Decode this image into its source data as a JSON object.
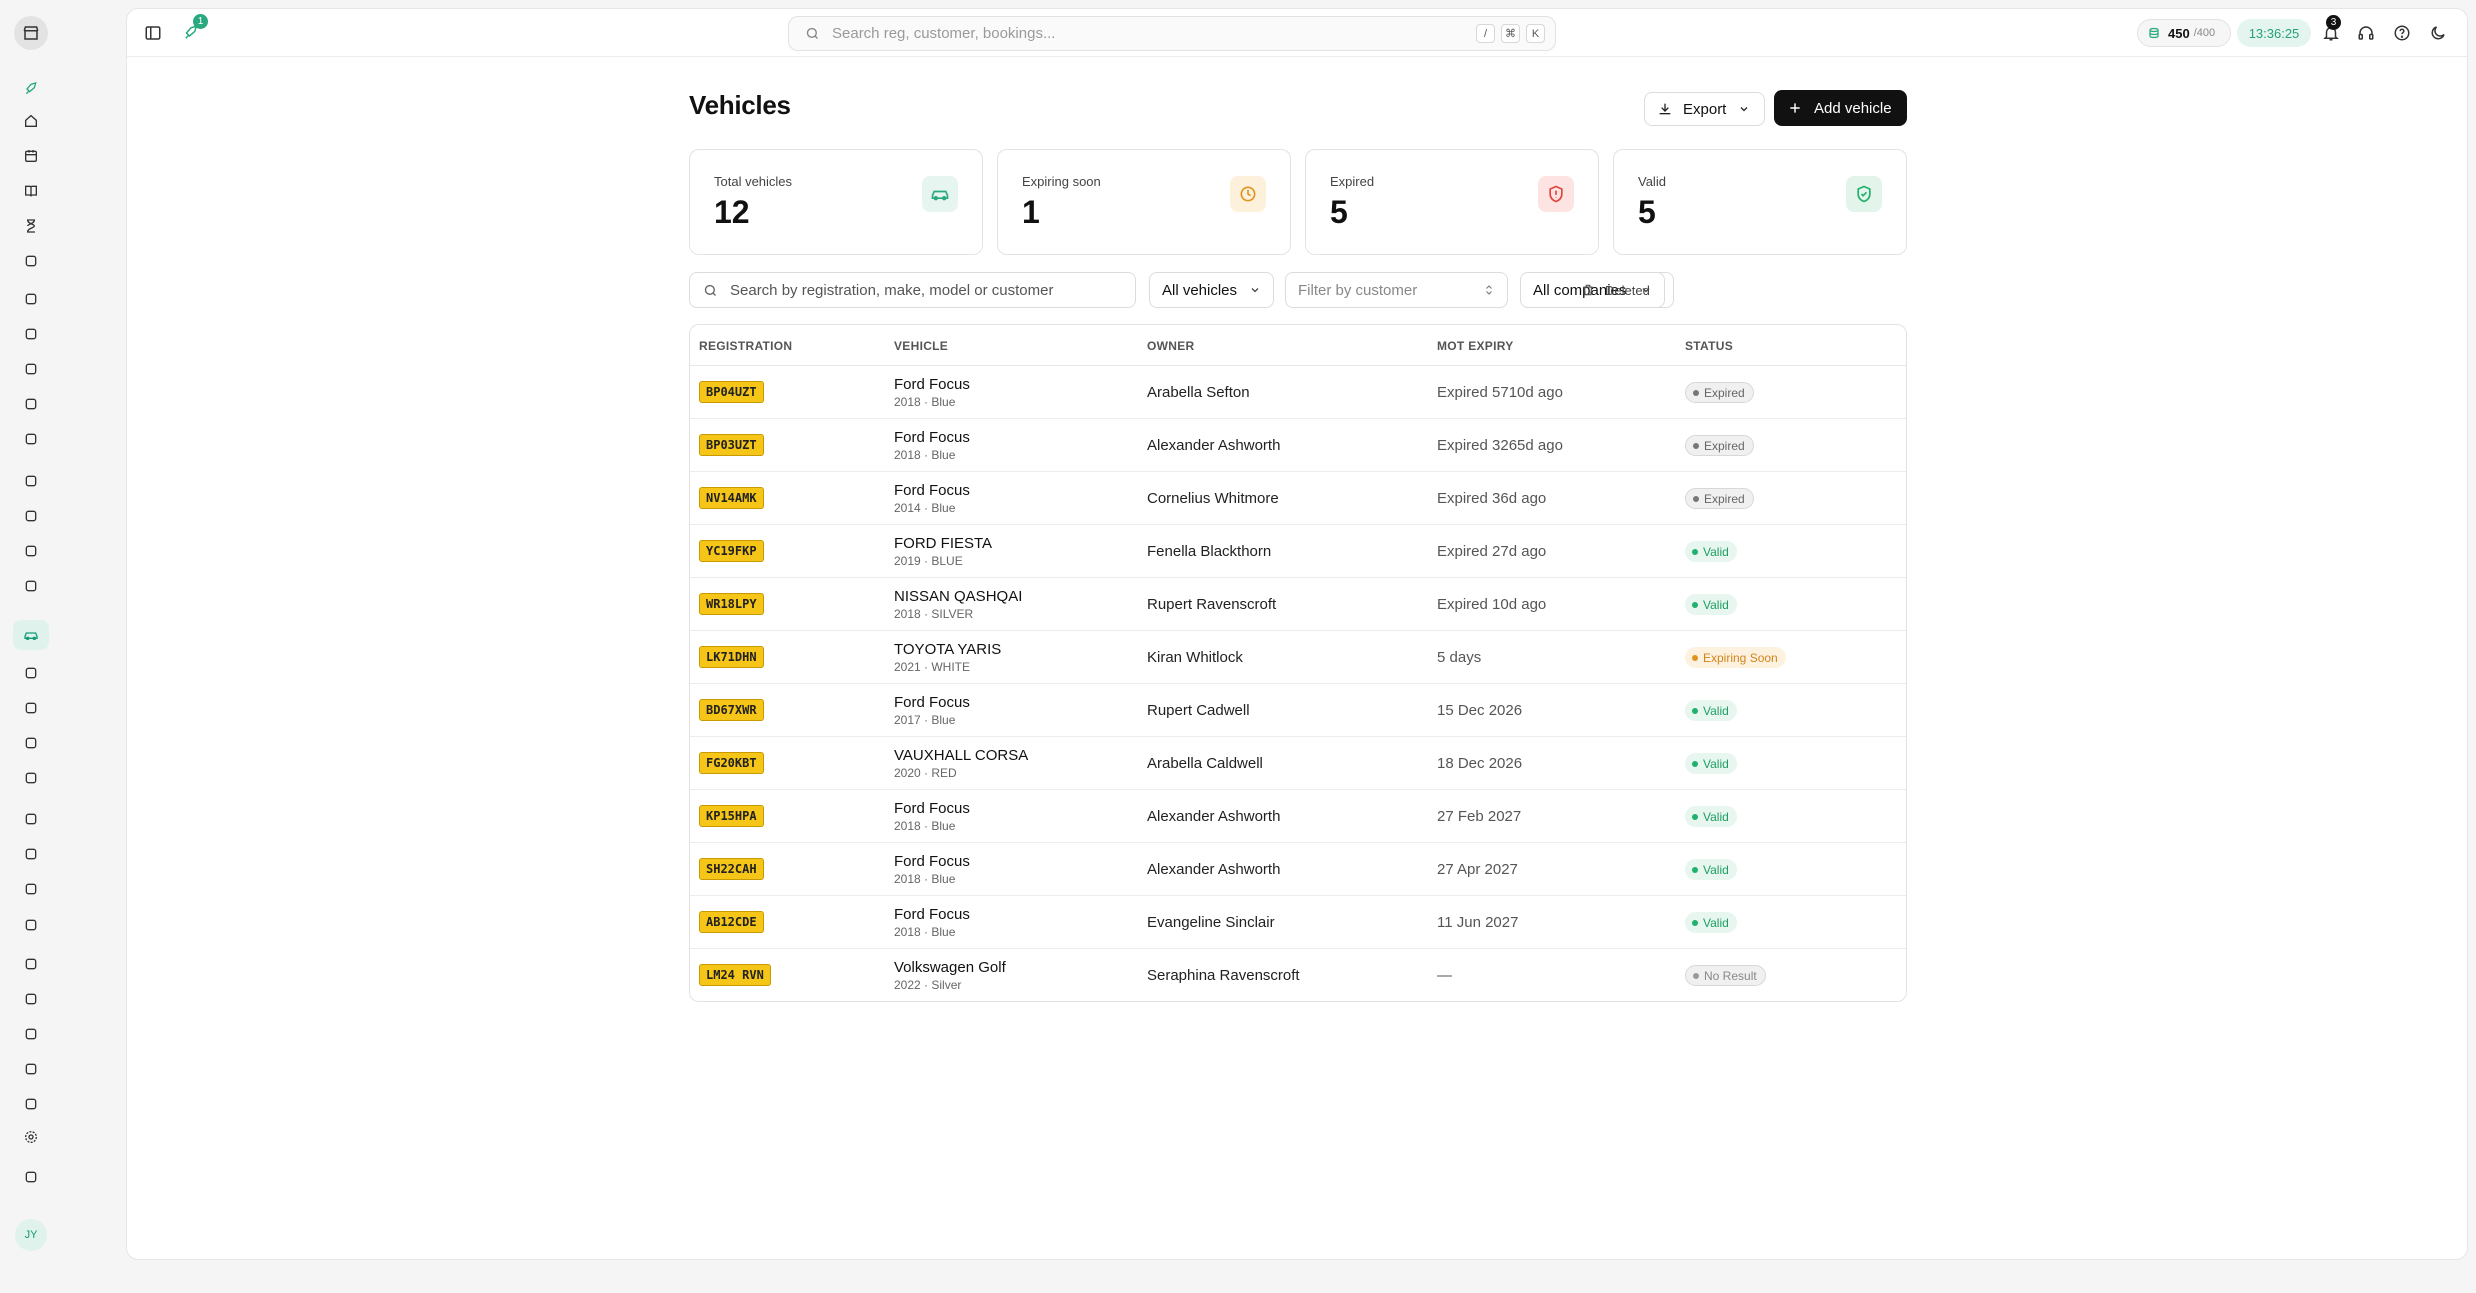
{
  "topbar": {
    "search_placeholder": "Search reg, customer, bookings...",
    "kbd": [
      "/",
      "⌘",
      "K"
    ],
    "activity_badge": "1",
    "credits_value": "450",
    "credits_total": "/400",
    "clock": "13:36:25",
    "notifications_count": "3"
  },
  "sidebar": {
    "avatar_initials": "JY",
    "icons": [
      "rocket-icon",
      "home-icon",
      "calendar-icon",
      "book-icon",
      "hourglass-icon",
      "wrench-icon",
      "inbox-icon",
      "users-icon",
      "garage-icon",
      "clipboard-icon",
      "star-icon",
      "document-icon",
      "receipt-icon",
      "bank-icon",
      "gift-icon",
      "car-icon",
      "tools-icon",
      "truck-icon",
      "cart-icon",
      "package-icon",
      "megaphone-icon",
      "checklist-icon",
      "team-icon",
      "info-icon",
      "sparkles-icon",
      "report-icon",
      "user-check-icon",
      "chart-icon",
      "folder-icon",
      "settings-icon",
      "sliders-icon"
    ]
  },
  "page": {
    "title": "Vehicles",
    "export_label": "Export",
    "add_label": "Add vehicle"
  },
  "stats": [
    {
      "label": "Total vehicles",
      "value": "12",
      "icon": "car-icon",
      "color": "#2aa87f",
      "bg": "#e6f5ef"
    },
    {
      "label": "Expiring soon",
      "value": "1",
      "icon": "clock-icon",
      "color": "#e0941e",
      "bg": "#fdf1dc"
    },
    {
      "label": "Expired",
      "value": "5",
      "icon": "shield-alert-icon",
      "color": "#e0463f",
      "bg": "#fde4e2"
    },
    {
      "label": "Valid",
      "value": "5",
      "icon": "shield-check-icon",
      "color": "#21b06d",
      "bg": "#e3f5ea"
    }
  ],
  "filters": {
    "search_placeholder": "Search by registration, make, model or customer",
    "vehicles_select": "All vehicles",
    "customer_placeholder": "Filter by customer",
    "companies_select": "All companies",
    "deleted_label": "Deleted"
  },
  "table": {
    "headers": [
      "REGISTRATION",
      "VEHICLE",
      "OWNER",
      "MOT EXPIRY",
      "STATUS"
    ],
    "rows": [
      {
        "reg": "BP04UZT",
        "vehicle": "Ford Focus",
        "sub": "2018 · Blue",
        "owner": "Arabella Sefton",
        "expiry": "Expired 5710d ago",
        "status": "Expired",
        "kind": "expired"
      },
      {
        "reg": "BP03UZT",
        "vehicle": "Ford Focus",
        "sub": "2018 · Blue",
        "owner": "Alexander Ashworth",
        "expiry": "Expired 3265d ago",
        "status": "Expired",
        "kind": "expired"
      },
      {
        "reg": "NV14AMK",
        "vehicle": "Ford Focus",
        "sub": "2014 · Blue",
        "owner": "Cornelius Whitmore",
        "expiry": "Expired 36d ago",
        "status": "Expired",
        "kind": "expired"
      },
      {
        "reg": "YC19FKP",
        "vehicle": "FORD FIESTA",
        "sub": "2019 · BLUE",
        "owner": "Fenella Blackthorn",
        "expiry": "Expired 27d ago",
        "status": "Valid",
        "kind": "valid"
      },
      {
        "reg": "WR18LPY",
        "vehicle": "NISSAN QASHQAI",
        "sub": "2018 · SILVER",
        "owner": "Rupert Ravenscroft",
        "expiry": "Expired 10d ago",
        "status": "Valid",
        "kind": "valid"
      },
      {
        "reg": "LK71DHN",
        "vehicle": "TOYOTA YARIS",
        "sub": "2021 · WHITE",
        "owner": "Kiran Whitlock",
        "expiry": "5 days",
        "status": "Expiring Soon",
        "kind": "soon"
      },
      {
        "reg": "BD67XWR",
        "vehicle": "Ford Focus",
        "sub": "2017 · Blue",
        "owner": "Rupert Cadwell",
        "expiry": "15 Dec 2026",
        "status": "Valid",
        "kind": "valid"
      },
      {
        "reg": "FG20KBT",
        "vehicle": "VAUXHALL CORSA",
        "sub": "2020 · RED",
        "owner": "Arabella Caldwell",
        "expiry": "18 Dec 2026",
        "status": "Valid",
        "kind": "valid"
      },
      {
        "reg": "KP15HPA",
        "vehicle": "Ford Focus",
        "sub": "2018 · Blue",
        "owner": "Alexander Ashworth",
        "expiry": "27 Feb 2027",
        "status": "Valid",
        "kind": "valid"
      },
      {
        "reg": "SH22CAH",
        "vehicle": "Ford Focus",
        "sub": "2018 · Blue",
        "owner": "Alexander Ashworth",
        "expiry": "27 Apr 2027",
        "status": "Valid",
        "kind": "valid"
      },
      {
        "reg": "AB12CDE",
        "vehicle": "Ford Focus",
        "sub": "2018 · Blue",
        "owner": "Evangeline Sinclair",
        "expiry": "11 Jun 2027",
        "status": "Valid",
        "kind": "valid"
      },
      {
        "reg": "LM24 RVN",
        "vehicle": "Volkswagen Golf",
        "sub": "2022 · Silver",
        "owner": "Seraphina Ravenscroft",
        "expiry": "—",
        "status": "No Result",
        "kind": "none"
      }
    ]
  }
}
